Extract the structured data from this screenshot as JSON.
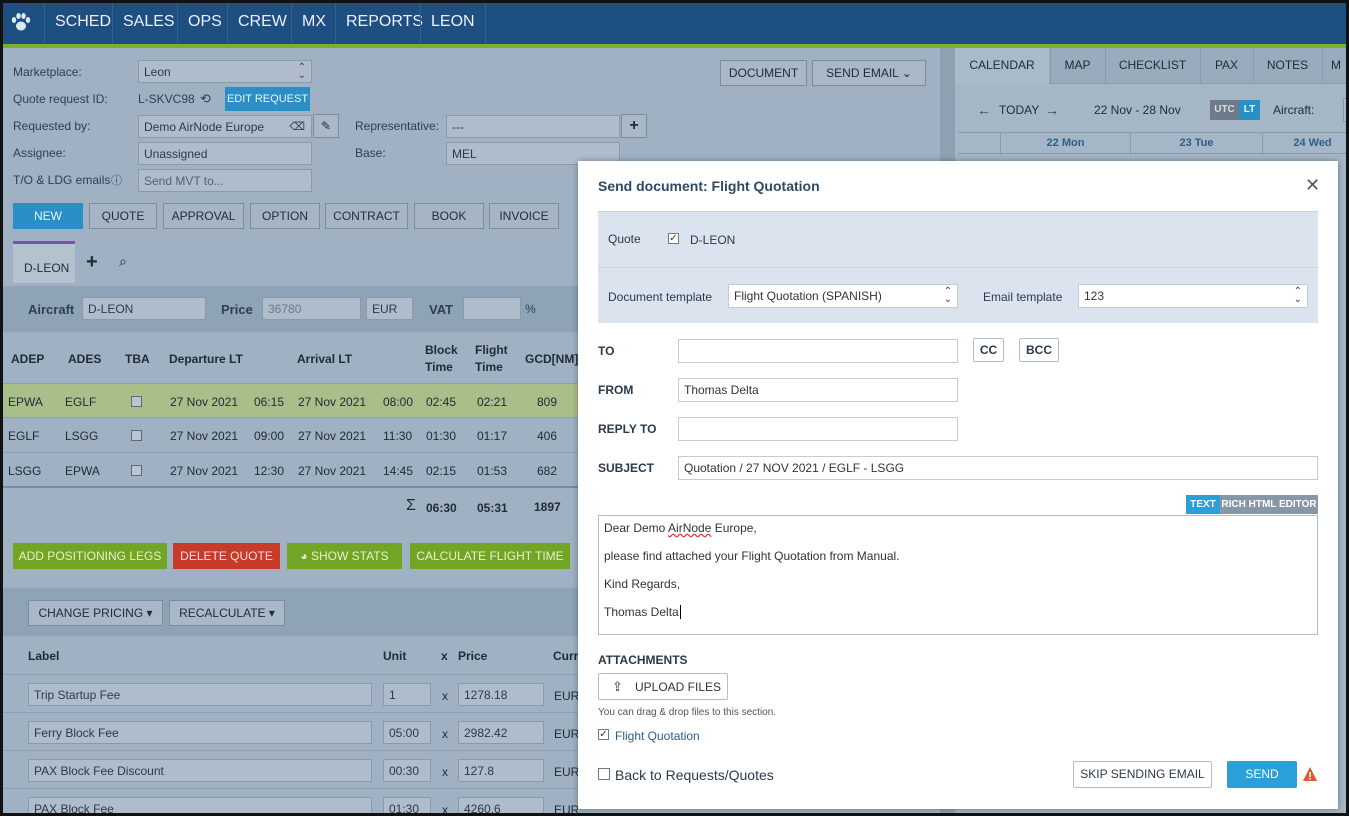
{
  "nav": {
    "items": [
      "SCHED",
      "SALES",
      "OPS",
      "CREW",
      "MX",
      "REPORTS",
      "LEON"
    ]
  },
  "form": {
    "marketplace_label": "Marketplace:",
    "marketplace_value": "Leon",
    "quote_id_label": "Quote request ID:",
    "quote_id_value": "L-SKVC98",
    "edit_request": "EDIT REQUEST",
    "requested_by_label": "Requested by:",
    "requested_by_value": "Demo AirNode Europe",
    "representative_label": "Representative:",
    "representative_value": "---",
    "assignee_label": "Assignee:",
    "assignee_value": "Unassigned",
    "base_label": "Base:",
    "base_value": "MEL",
    "emails_label": "T/O & LDG emails",
    "emails_placeholder": "Send MVT to...",
    "document_btn": "DOCUMENT",
    "send_email_btn": "SEND EMAIL"
  },
  "steps": [
    "NEW",
    "QUOTE",
    "APPROVAL",
    "OPTION",
    "CONTRACT",
    "BOOK",
    "INVOICE"
  ],
  "tab": {
    "label": "D-LEON"
  },
  "aircraft_bar": {
    "aircraft_label": "Aircraft",
    "aircraft_value": "D-LEON",
    "price_label": "Price",
    "price_value": "36780",
    "currency": "EUR",
    "vat_label": "VAT",
    "pct": "%"
  },
  "legs": {
    "headers": [
      "ADEP",
      "ADES",
      "TBA",
      "Departure LT",
      "Arrival LT",
      "Block",
      "Time",
      "Flight",
      "Time",
      "GCD[NM]"
    ],
    "rows": [
      {
        "adep": "EPWA",
        "ades": "EGLF",
        "dep_date": "27 Nov 2021",
        "dep_time": "06:15",
        "arr_date": "27 Nov 2021",
        "arr_time": "08:00",
        "block": "02:45",
        "flight": "02:21",
        "gcd": "809"
      },
      {
        "adep": "EGLF",
        "ades": "LSGG",
        "dep_date": "27 Nov 2021",
        "dep_time": "09:00",
        "arr_date": "27 Nov 2021",
        "arr_time": "11:30",
        "block": "01:30",
        "flight": "01:17",
        "gcd": "406"
      },
      {
        "adep": "LSGG",
        "ades": "EPWA",
        "dep_date": "27 Nov 2021",
        "dep_time": "12:30",
        "arr_date": "27 Nov 2021",
        "arr_time": "14:45",
        "block": "02:15",
        "flight": "01:53",
        "gcd": "682"
      }
    ],
    "sum_symbol": "Σ",
    "total_block": "06:30",
    "total_flight": "05:31",
    "total_gcd": "1897"
  },
  "actions": {
    "add_positioning": "ADD POSITIONING LEGS",
    "delete_quote": "DELETE QUOTE",
    "show_stats": "SHOW STATS",
    "calc_time": "CALCULATE FLIGHT TIME"
  },
  "pricing": {
    "change_pricing": "CHANGE PRICING ▾",
    "recalculate": "RECALCULATE ▾",
    "headers": {
      "label": "Label",
      "unit": "Unit",
      "x": "x",
      "price": "Price",
      "curr": "Curr"
    },
    "rows": [
      {
        "label": "Trip Startup Fee",
        "unit": "1",
        "x": "x",
        "price": "1278.18",
        "curr": "EUR"
      },
      {
        "label": "Ferry Block Fee",
        "unit": "05:00",
        "x": "x",
        "price": "2982.42",
        "curr": "EUR"
      },
      {
        "label": "PAX Block Fee Discount",
        "unit": "00:30",
        "x": "x",
        "price": "127.8",
        "curr": "EUR"
      },
      {
        "label": "PAX Block Fee",
        "unit": "01:30",
        "x": "x",
        "price": "4260.6",
        "curr": "EUR"
      }
    ]
  },
  "right_panel": {
    "tabs": [
      "CALENDAR",
      "MAP",
      "CHECKLIST",
      "PAX",
      "NOTES",
      "M"
    ],
    "today": "TODAY",
    "range": "22 Nov - 28 Nov",
    "utc": "UTC",
    "lt": "LT",
    "aircraft_label": "Aircraft:",
    "days": [
      "22 Mon",
      "23 Tue",
      "24 Wed"
    ]
  },
  "modal": {
    "title": "Send document: Flight Quotation",
    "quote_label": "Quote",
    "quote_value": "D-LEON",
    "doc_template_label": "Document template",
    "doc_template_value": "Flight Quotation (SPANISH)",
    "email_template_label": "Email template",
    "email_template_value": "123",
    "to_label": "TO",
    "to_value": "",
    "cc": "CC",
    "bcc": "BCC",
    "from_label": "FROM",
    "from_value": "Thomas Delta",
    "reply_to_label": "REPLY TO",
    "reply_to_value": "",
    "subject_label": "SUBJECT",
    "subject_value": "Quotation / 27 NOV 2021 / EGLF - LSGG",
    "editor_text_tab": "TEXT",
    "editor_rich_tab": "RICH HTML EDITOR",
    "body_line1_a": "Dear Demo ",
    "body_line1_b": "AirNode",
    "body_line1_c": " Europe,",
    "body_line2": "please find attached your Flight Quotation from Manual.",
    "body_line3": "Kind Regards,",
    "body_line4": "Thomas Delta",
    "attachments_label": "ATTACHMENTS",
    "upload_files": "UPLOAD FILES",
    "drag_hint": "You can drag & drop files to this section.",
    "attachment_name": "Flight Quotation",
    "back_to_label": "Back to Requests/Quotes",
    "skip_btn": "SKIP SENDING EMAIL",
    "send_btn": "SEND"
  },
  "colors": {
    "nav": "#1d4f80",
    "accent": "#2a8fc4",
    "green": "#72a524",
    "red": "#c83b2a",
    "warning": "#e2572a"
  }
}
